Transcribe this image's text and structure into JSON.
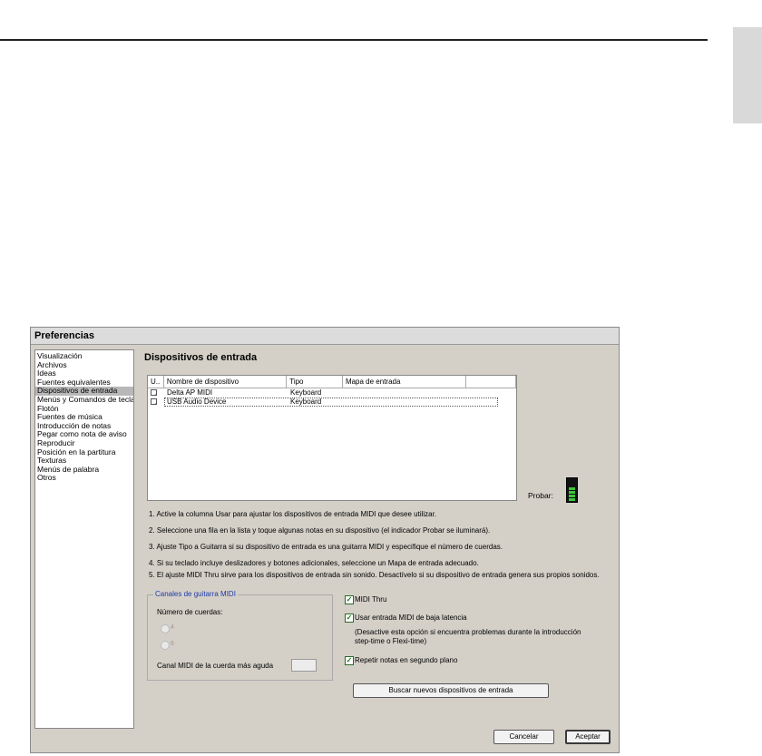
{
  "window": {
    "title": "Preferencias"
  },
  "sidebar": {
    "items": [
      {
        "label": "Visualización",
        "selected": false
      },
      {
        "label": "Archivos",
        "selected": false
      },
      {
        "label": "Ideas",
        "selected": false
      },
      {
        "label": "Fuentes equivalentes",
        "selected": false
      },
      {
        "label": "Dispositivos de entrada",
        "selected": true
      },
      {
        "label": "Menús y Comandos de teclado",
        "selected": false
      },
      {
        "label": "Flotón",
        "selected": false
      },
      {
        "label": "Fuentes de música",
        "selected": false
      },
      {
        "label": "Introducción de notas",
        "selected": false
      },
      {
        "label": "Pegar como nota de aviso",
        "selected": false
      },
      {
        "label": "Reproducir",
        "selected": false
      },
      {
        "label": "Posición en la partitura",
        "selected": false
      },
      {
        "label": "Texturas",
        "selected": false
      },
      {
        "label": "Menús de palabra",
        "selected": false
      },
      {
        "label": "Otros",
        "selected": false
      }
    ]
  },
  "main": {
    "title": "Dispositivos de entrada",
    "device_table": {
      "columns": [
        "U..",
        "Nombre de dispositivo",
        "Tipo",
        "Mapa de entrada",
        ""
      ],
      "rows": [
        {
          "use": "✓",
          "name": "Delta AP MIDI",
          "type": "Keyboard",
          "map": ""
        },
        {
          "use": "✓",
          "name": "USB Audio Device",
          "type": "Keyboard",
          "map": ""
        }
      ]
    },
    "test_label": "Probar:",
    "instructions": [
      "1. Active la columna Usar para ajustar los dispositivos de entrada MIDI que desee utilizar.",
      "2. Seleccione una fila en la lista y toque algunas notas en su dispositivo (el indicador Probar se iluminará).",
      "3. Ajuste Tipo a Guitarra si su dispositivo de entrada es una guitarra MIDI y especifique el número de cuerdas.",
      "4. Si su teclado incluye deslizadores y botones adicionales, seleccione un Mapa de entrada adecuado.",
      "5. El ajuste MIDI Thru sirve para los dispositivos de entrada sin sonido. Desactívelo si su dispositivo de entrada genera sus propios sonidos."
    ],
    "guitar_group": {
      "label": "Canales de guitarra MIDI",
      "strings_label": "Número de cuerdas:",
      "option_4": "4",
      "option_6": "6",
      "highest_channel_label": "Canal MIDI de la cuerda más aguda"
    },
    "options": {
      "midi_thru": "MIDI Thru",
      "low_latency": "Usar entrada MIDI de baja latencia",
      "low_latency_note_1": "(Desactive esta opción si encuentra problemas durante la introducción",
      "low_latency_note_2": "step-time o Flexi-time)",
      "background_repeat": "Repetir notas en segundo plano",
      "check": "✓"
    },
    "search_button": "Buscar nuevos dispositivos de entrada"
  },
  "footer": {
    "cancel": "Cancelar",
    "accept": "Aceptar"
  }
}
